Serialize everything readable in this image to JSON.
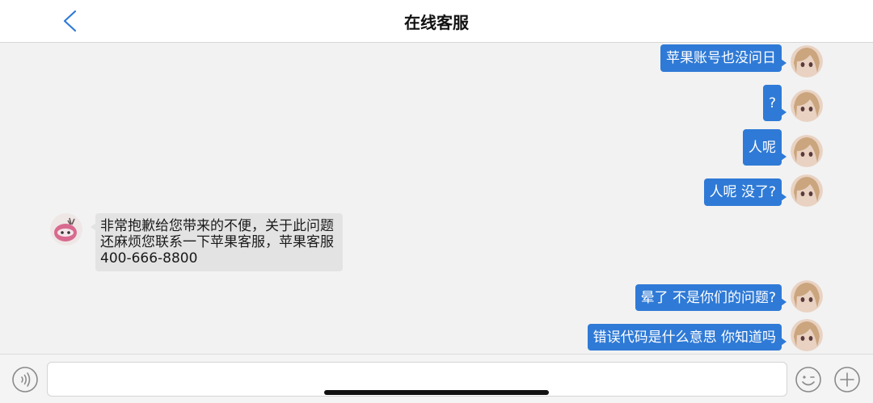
{
  "navbar": {
    "title": "在线客服",
    "back_icon": "chevron-left-icon",
    "back_color": "#2f7ad6"
  },
  "messages": [
    {
      "from": "user",
      "text": "苹果账号也没问日"
    },
    {
      "from": "user",
      "text": "?"
    },
    {
      "from": "user",
      "text": "人呢"
    },
    {
      "from": "user",
      "text": "人呢 没了?"
    },
    {
      "from": "agent",
      "lines": [
        "非常抱歉给您带来的不便，关于此问题",
        "还麻烦您联系一下苹果客服，苹果客服",
        "400-666-8800"
      ]
    },
    {
      "from": "user",
      "text": "晕了 不是你们的问题?"
    },
    {
      "from": "user",
      "text": "错误代码是什么意思 你知道吗"
    }
  ],
  "colors": {
    "user_bubble": "#2f7ad6",
    "agent_bubble": "#e3e3e3"
  },
  "input_bar": {
    "value": "",
    "voice_icon": "voice-icon",
    "emoji_icon": "emoji-icon",
    "plus_icon": "plus-icon"
  }
}
